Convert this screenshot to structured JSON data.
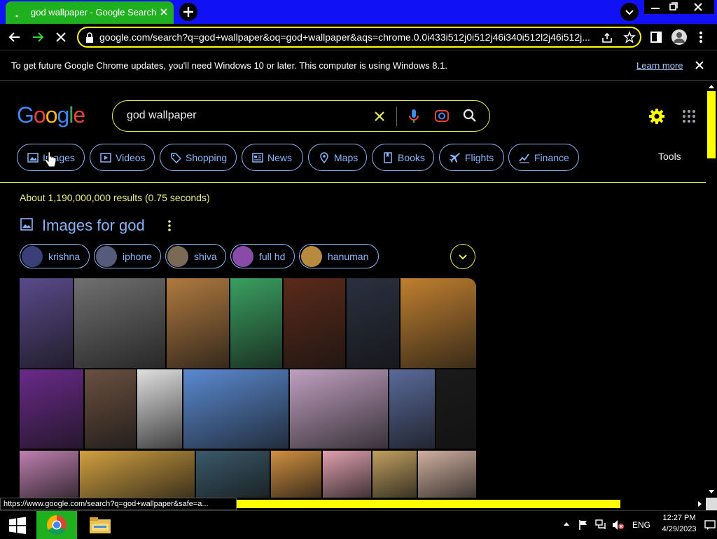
{
  "browser": {
    "tab_title": "god wallpaper - Google Search",
    "url": "google.com/search?q=god+wallpaper&oq=god+wallpaper&aqs=chrome.0.0i433i512j0i512j46i340i512l2j46i512j...",
    "status_url": "https://www.google.com/search?q=god+wallpaper&safe=a..."
  },
  "infobar": {
    "message": "To get future Google Chrome updates, you'll need Windows 10 or later. This computer is using Windows 8.1.",
    "link": "Learn more"
  },
  "search": {
    "query": "god wallpaper",
    "tools_label": "Tools",
    "results_stats": "About 1,190,000,000 results (0.75 seconds)"
  },
  "chips": [
    {
      "label": "Images",
      "icon": "image-icon"
    },
    {
      "label": "Videos",
      "icon": "video-icon"
    },
    {
      "label": "Shopping",
      "icon": "tag-icon"
    },
    {
      "label": "News",
      "icon": "newspaper-icon"
    },
    {
      "label": "Maps",
      "icon": "pin-icon"
    },
    {
      "label": "Books",
      "icon": "book-icon"
    },
    {
      "label": "Flights",
      "icon": "plane-icon"
    },
    {
      "label": "Finance",
      "icon": "finance-icon"
    }
  ],
  "images_section": {
    "heading": "Images for god",
    "filters": [
      {
        "label": "krishna",
        "color": "#3a3f7a"
      },
      {
        "label": "iphone",
        "color": "#555b7a"
      },
      {
        "label": "shiva",
        "color": "#7a6a55"
      },
      {
        "label": "full hd",
        "color": "#8a4aa8"
      },
      {
        "label": "hanuman",
        "color": "#b88a40"
      }
    ]
  },
  "thumbnail_colors": {
    "row1": [
      "#5a4a8a",
      "#707070",
      "#b07a40",
      "#3aa060",
      "#5a2a1a",
      "#2a3040",
      "#c08030"
    ],
    "row2": [
      "#6a2a8a",
      "#6a5040",
      "#e0e0e0",
      "#5a8ad0",
      "#c0a0c0",
      "#5a6a9a",
      "#1a1a1a"
    ],
    "row3": [
      "#c080b0",
      "#d0a040",
      "#3a5a6a",
      "#d09040",
      "#e0a0b0",
      "#c0a060",
      "#d0b0a0"
    ]
  },
  "taskbar": {
    "lang": "ENG",
    "time": "12:27 PM",
    "date": "4/29/2023"
  },
  "colors": {
    "titlebar": "#1111f5",
    "tab": "#1fb01f",
    "accent_yellow": "#ffff00",
    "link_blue": "#8ab4f8"
  }
}
